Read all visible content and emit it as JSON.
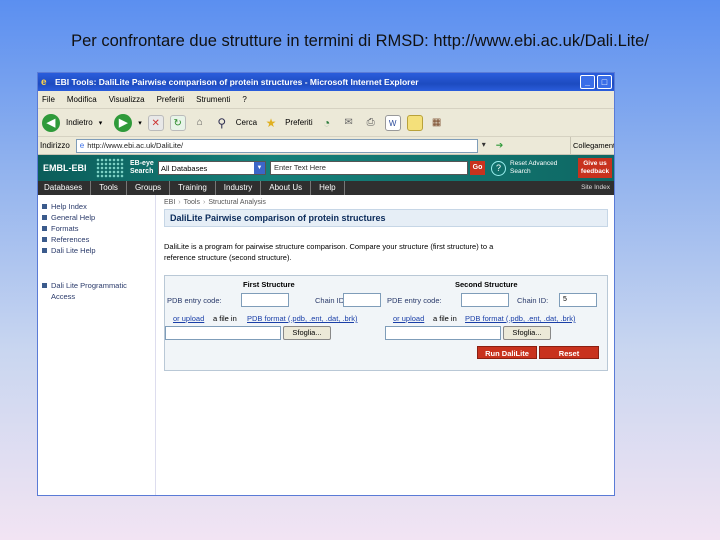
{
  "slide": {
    "title": "Per confrontare due strutture in termini di RMSD: http://www.ebi.ac.uk/Dali.Lite/"
  },
  "window": {
    "title": "EBI Tools: DaliLite Pairwise comparison of protein structures - Microsoft Internet Explorer",
    "minimize": "_",
    "maximize": "□"
  },
  "menu": [
    "File",
    "Modifica",
    "Visualizza",
    "Preferiti",
    "Strumenti",
    "?"
  ],
  "toolbar": {
    "back_label": "Indietro",
    "search_label": "Cerca",
    "favorites_label": "Preferiti"
  },
  "address": {
    "label": "Indirizzo",
    "url": "http://www.ebi.ac.uk/DaliLite/",
    "links_label": "Collegamenti"
  },
  "ebi": {
    "logo": "EMBL-EBI",
    "search_label": "EB-eye Search",
    "db_select": "All Databases",
    "text_placeholder": "Enter Text Here",
    "go_label": "Go",
    "help_icon": "?",
    "advanced_search": "Reset Advanced Search",
    "feedback": "Give us feedback"
  },
  "nav": {
    "items": [
      "Databases",
      "Tools",
      "Groups",
      "Training",
      "Industry",
      "About Us",
      "Help"
    ],
    "site_index": "Site Index"
  },
  "sidebar": {
    "items": [
      "Help Index",
      "General Help",
      "Formats",
      "References",
      "Dali Lite Help"
    ],
    "extra": [
      "Dali Lite Programmatic",
      "Access"
    ]
  },
  "breadcrumb": [
    "EBI",
    "Tools",
    "Structural Analysis"
  ],
  "page": {
    "title": "DaliLite Pairwise comparison of protein structures",
    "intro_1": "DaliLite is a program for pairwise structure comparison. Compare your structure (first structure) to a",
    "intro_2": "reference structure (second structure)."
  },
  "form": {
    "first_heading": "First Structure",
    "second_heading": "Second Structure",
    "pdb_label_1": "PDB entry code:",
    "chain_label_1": "Chain ID:",
    "pdb_label_2": "PDE entry code:",
    "chain_label_2": "Chain ID:",
    "chain_value_2": "5",
    "or_upload": "or upload",
    "file_in": "a file in",
    "pdb_format_1": "PDB format (.pdb, .ent, .dat, .brk)",
    "pdb_format_2": "PDB format (.pdb, .ent, .dat, .brk)",
    "browse_1": "Sfoglia...",
    "browse_2": "Sfoglia...",
    "run_label": "Run DaliLite",
    "reset_label": "Reset"
  }
}
